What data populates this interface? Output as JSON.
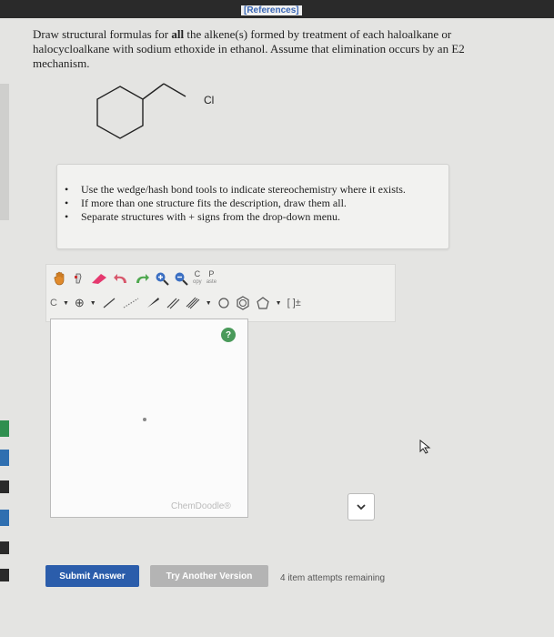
{
  "header": {
    "references_link": "[References]"
  },
  "question": {
    "line1_pre": "Draw structural formulas for ",
    "line1_bold": "all",
    "line1_post": " the alkene(s) formed by treatment of each haloalkane or",
    "line2": "halocycloalkane with sodium ethoxide in ethanol. Assume that elimination occurs by an E2",
    "line3": "mechanism."
  },
  "molecule": {
    "atom_label": "Cl"
  },
  "instructions": [
    "Use the wedge/hash bond tools to indicate stereochemistry where it exists.",
    "If more than one structure fits the description, draw them all.",
    "Separate structures with + signs from the drop-down menu."
  ],
  "toolbar": {
    "copy_big": "C",
    "copy_small": "opy",
    "paste_big": "P",
    "paste_small": "aste",
    "carbon_label": "C",
    "charge_label": "⊕",
    "bracket_label": "[ ]±"
  },
  "canvas": {
    "watermark": "ChemDoodle®",
    "help_label": "?"
  },
  "actions": {
    "submit_label": "Submit Answer",
    "try_another_label": "Try Another Version",
    "attempts_text": "4 item attempts remaining"
  },
  "colors": {
    "primary_button": "#2b5dab",
    "secondary_button": "#b4b4b4",
    "help_green": "#4a9a5a",
    "link_blue": "#3a67b5"
  }
}
